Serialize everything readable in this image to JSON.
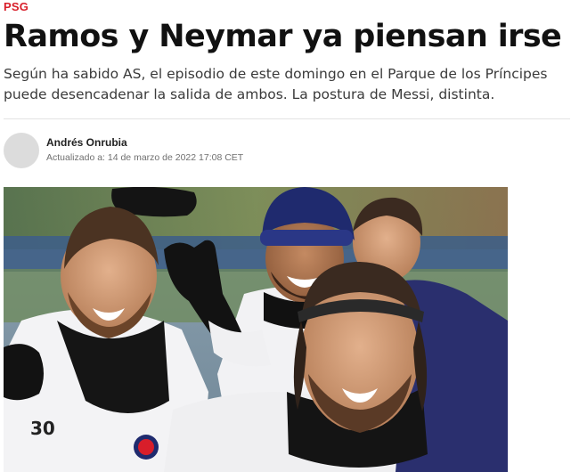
{
  "article": {
    "section": "PSG",
    "headline": "Ramos y Neymar ya piensan irse",
    "lead": "Según ha sabido AS, el episodio de este domingo en el Parque de los Príncipes puede desencadenar la salida de ambos. La postura de Messi, distinta.",
    "author": "Andrés Onrubia",
    "updated": "Actualizado a: 14 de marzo de 2022 17:08 CET",
    "photo": {
      "shirt_number": "30"
    }
  },
  "colors": {
    "section_red": "#d81e2a",
    "neymar_beanie": "#1f2a6e",
    "pitch": "#5a7c4a",
    "sky": "#7f98ab"
  }
}
